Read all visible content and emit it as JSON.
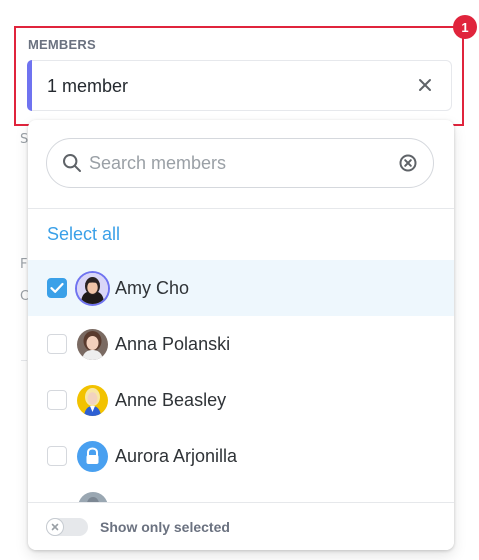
{
  "field": {
    "label": "MEMBERS",
    "value": "1 member",
    "clear_icon": "close-icon"
  },
  "badge": {
    "count": "1",
    "color": "#e0243c"
  },
  "background_glyphs": {
    "glyph_1": "S",
    "glyph_2": "F",
    "glyph_3": "C"
  },
  "dropdown": {
    "search": {
      "placeholder": "Search members",
      "icon": "search-icon",
      "clear_icon": "clear-circle-icon"
    },
    "select_all_label": "Select all",
    "members": [
      {
        "name": "Amy Cho",
        "checked": true,
        "avatar": "photo"
      },
      {
        "name": "Anna Polanski",
        "checked": false,
        "avatar": "photo"
      },
      {
        "name": "Anne Beasley",
        "checked": false,
        "avatar": "photo"
      },
      {
        "name": "Aurora Arjonilla",
        "checked": false,
        "avatar": "user-placeholder-icon"
      }
    ],
    "footer": {
      "toggle_label": "Show only selected",
      "toggle_on": false
    }
  },
  "colors": {
    "accent": "#6f73f0",
    "link": "#3aa0e8",
    "selected_row": "#eef7fd"
  }
}
